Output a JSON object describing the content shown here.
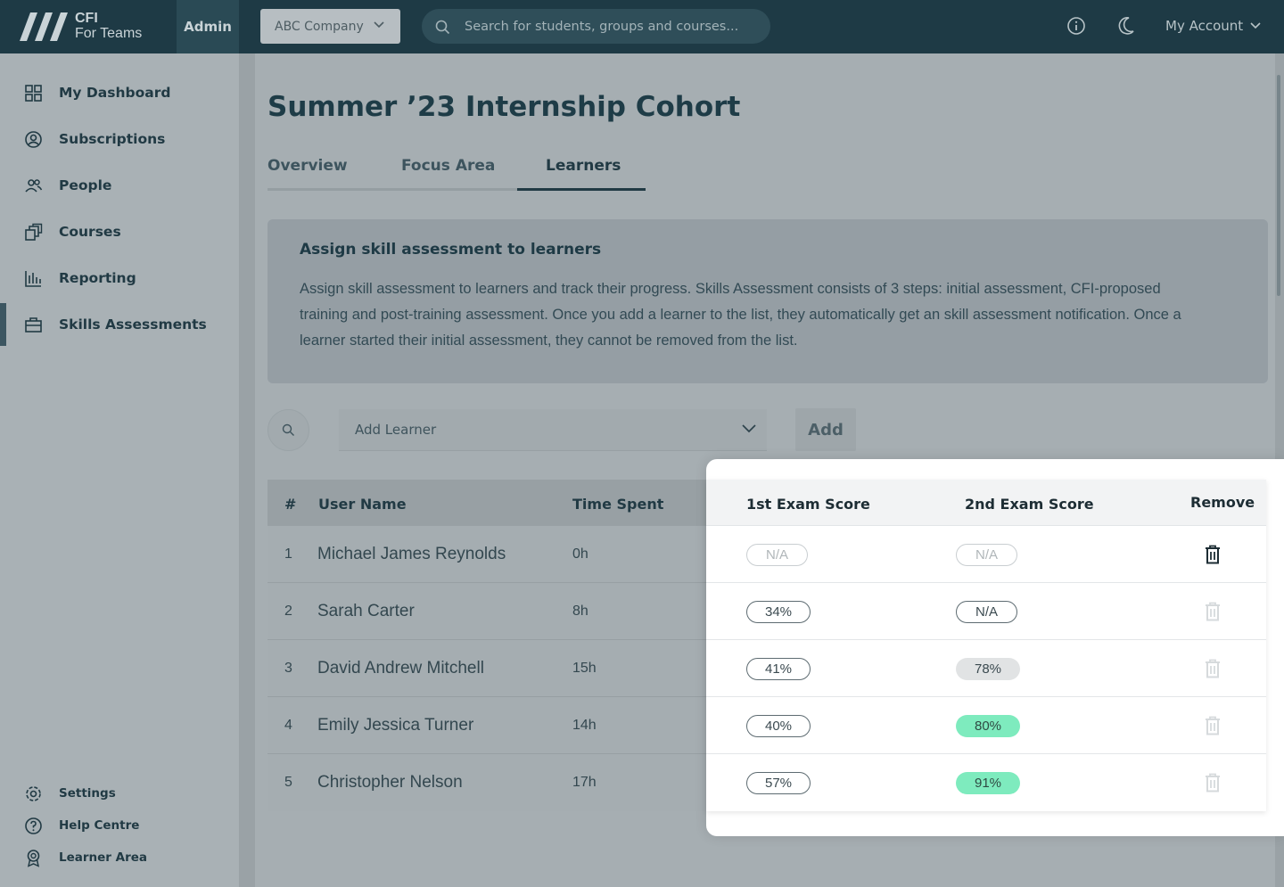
{
  "topbar": {
    "logo_line1": "CFI",
    "logo_line2": "For Teams",
    "admin_label": "Admin",
    "company_value": "ABC Company",
    "search_placeholder": "Search for students, groups and courses...",
    "account_label": "My Account",
    "icons": [
      "info-icon",
      "moon-icon",
      "chevron-down-icon"
    ]
  },
  "sidebar": {
    "items": [
      {
        "label": "My Dashboard",
        "icon": "grid-icon"
      },
      {
        "label": "Subscriptions",
        "icon": "user-circle-icon"
      },
      {
        "label": "People",
        "icon": "people-icon"
      },
      {
        "label": "Courses",
        "icon": "courses-icon"
      },
      {
        "label": "Reporting",
        "icon": "bar-chart-icon"
      },
      {
        "label": "Skills Assessments",
        "icon": "briefcase-icon",
        "active": true
      }
    ],
    "bottom_items": [
      {
        "label": "Settings",
        "icon": "gear-icon"
      },
      {
        "label": "Help Centre",
        "icon": "help-icon"
      },
      {
        "label": "Learner Area",
        "icon": "badge-icon"
      }
    ]
  },
  "page": {
    "title": "Summer ’23 Internship Cohort",
    "tabs": [
      "Overview",
      "Focus Area",
      "Learners"
    ],
    "active_tab": "Learners"
  },
  "info": {
    "title": "Assign skill assessment to learners",
    "body": "Assign skill assessment to learners and track their progress. Skills Assessment consists of 3 steps: initial assessment, CFI-proposed training and post-training assessment. Once you add a learner to the list, they automatically get an skill assessment notification. Once a learner started their initial assessment, they cannot be removed from the list."
  },
  "add_learner": {
    "placeholder": "Add Learner",
    "button": "Add"
  },
  "table": {
    "headers": {
      "num": "#",
      "name": "User Name",
      "time": "Time Spent",
      "score1": "1st Exam Score",
      "score2": "2nd Exam Score",
      "remove": "Remove"
    },
    "rows": [
      {
        "num": "1",
        "name": "Michael James Reynolds",
        "time": "0h",
        "score1": "N/A",
        "score2": "N/A",
        "removable": true
      },
      {
        "num": "2",
        "name": "Sarah Carter",
        "time": "8h",
        "score1": "34%",
        "score2": "N/A",
        "removable": false
      },
      {
        "num": "3",
        "name": "David Andrew Mitchell",
        "time": "15h",
        "score1": "41%",
        "score2": "78%",
        "removable": false
      },
      {
        "num": "4",
        "name": "Emily Jessica Turner",
        "time": "14h",
        "score1": "40%",
        "score2": "80%",
        "removable": false
      },
      {
        "num": "5",
        "name": "Christopher Nelson",
        "time": "17h",
        "score1": "57%",
        "score2": "91%",
        "removable": false
      }
    ]
  },
  "colors": {
    "topbar": "#1e3a45",
    "pass_green": "#7eebbe",
    "overlay_grey": "#a6aeb2"
  }
}
